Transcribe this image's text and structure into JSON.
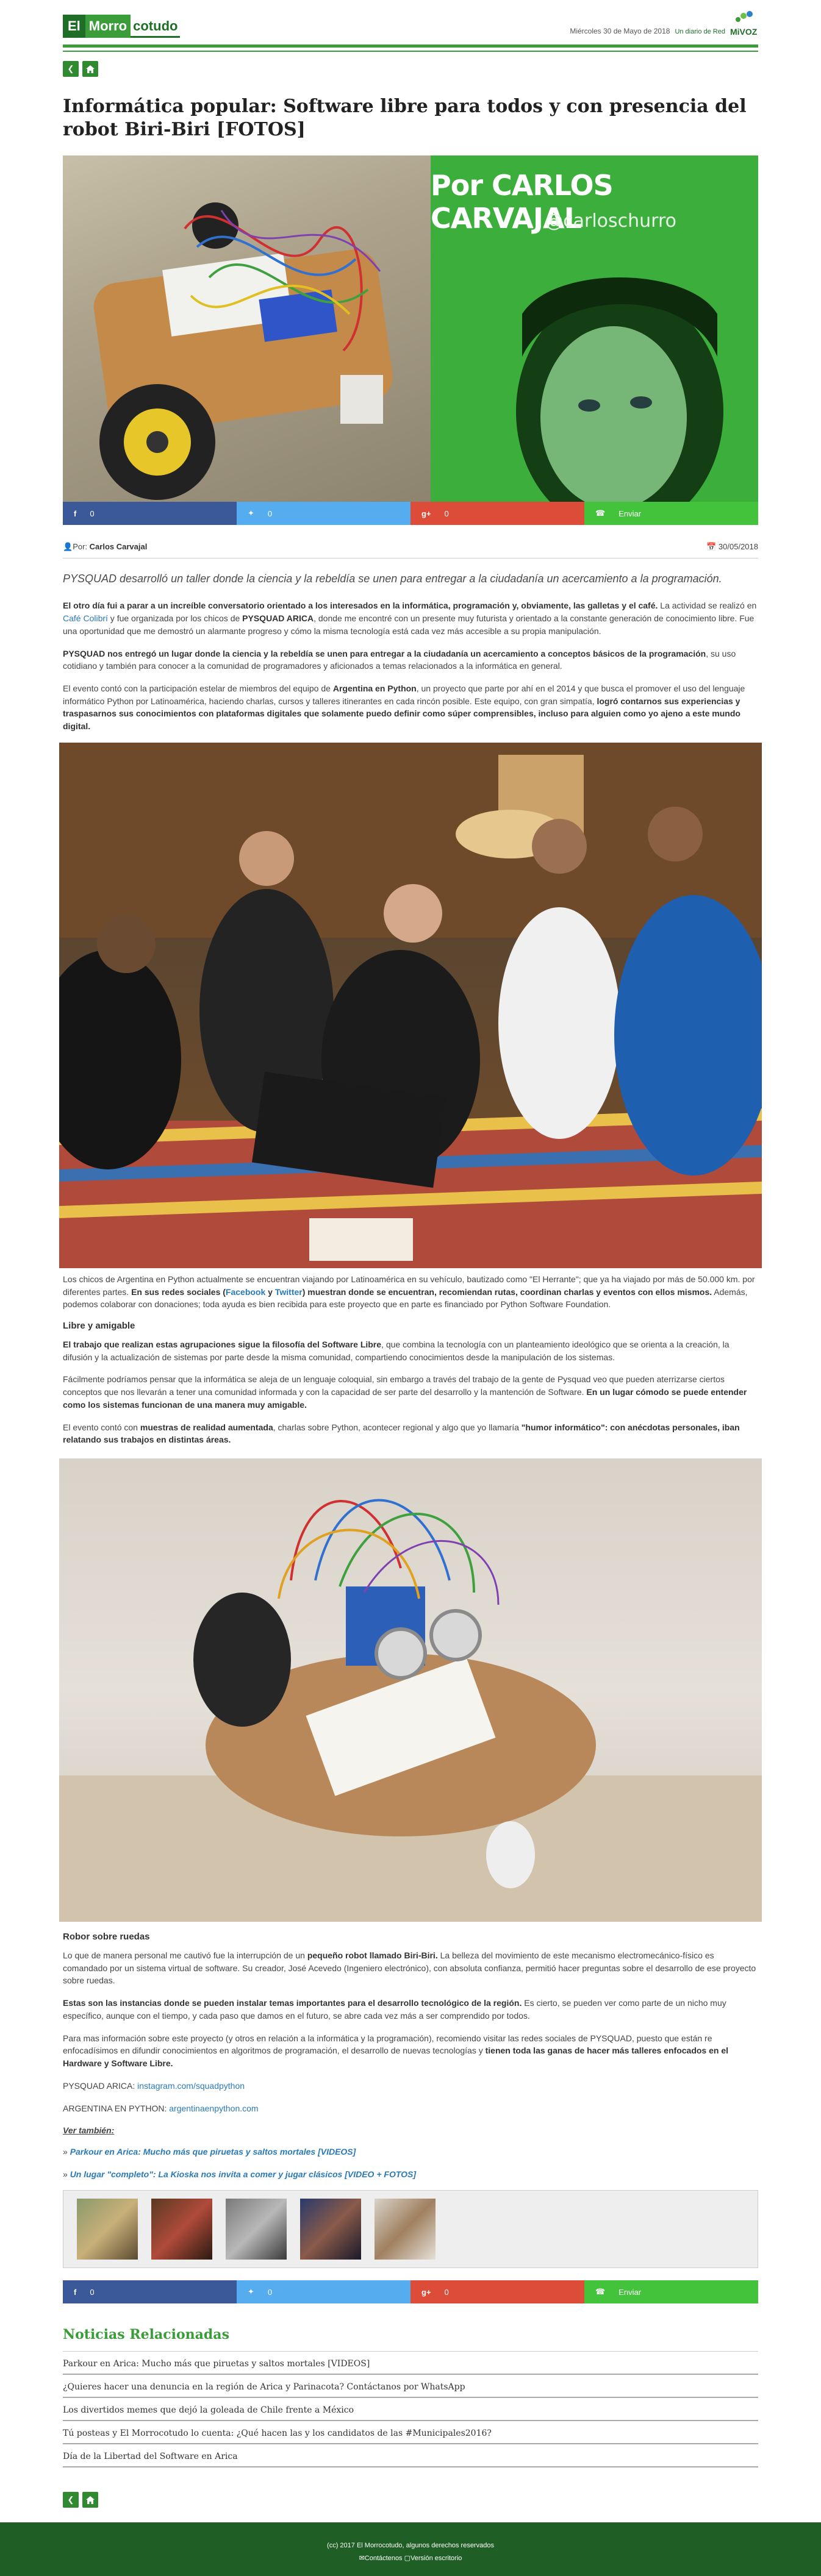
{
  "header": {
    "logo_part1": "El",
    "logo_part2": "Morro",
    "logo_part3": "cotudo",
    "date": "Miércoles 30 de Mayo de 2018",
    "network": "Un diario de Red",
    "network_brand": "MiVOZ"
  },
  "nav": {
    "back_icon": "chevron-left-icon",
    "home_icon": "home-icon"
  },
  "article": {
    "title": "Informática popular: Software libre para todos y con presencia del robot Biri-Biri [FOTOS]",
    "hero_name": "Por CARLOS CARVAJAL",
    "hero_handle": "@carloschurro",
    "author_prefix": "Por:",
    "author": "Carlos Carvajal",
    "date": "30/05/2018",
    "lead": "PYSQUAD desarrolló un taller donde la ciencia y la rebeldía se unen para entregar a la ciudadanía un acercamiento a la programación.",
    "p1_b": "El otro día fui a parar a un increíble conversatorio orientado a los interesados en la informática, programación y, obviamente, las galletas y el café.",
    "p1_a": " La actividad se realizó en ",
    "p1_link": "Café Colibrí",
    "p1_c": " y fue organizada por los chicos de ",
    "p1_b2": "PYSQUAD ARICA",
    "p1_d": ", donde me encontré con un presente muy futurista y orientado a la constante generación de conocimiento libre. Fue una oportunidad que me demostró un alarmante progreso y cómo la misma tecnología está cada vez más accesible a su propia manipulación.",
    "p2_b": "PYSQUAD nos entregó un lugar donde la ciencia y la rebeldía se unen para entregar a la ciudadanía un acercamiento a conceptos básicos de la programación",
    "p2_a": ", su uso cotidiano y también para conocer a la comunidad de programadores y aficionados a temas relacionados a la informática en general.",
    "p3_a": "El evento contó con la participación estelar de miembros del equipo de ",
    "p3_b": "Argentina en Python",
    "p3_c": ", un proyecto que parte por ahí en el 2014 y que busca el promover el uso del lenguaje informático Python por Latinoamérica, haciendo charlas, cursos y talleres itinerantes en cada rincón posible. Este equipo, con gran simpatía, ",
    "p3_d": "logró contarnos sus experiencias y traspasarnos sus conocimientos con plataformas digitales que solamente puedo definir como súper comprensibles, incluso para alguien como yo ajeno a este mundo digital.",
    "caption1_a": "Los chicos de Argentina en Python actualmente se encuentran viajando por Latinoamérica en su vehículo, bautizado como \"El Herrante\"; que ya ha viajado por más de 50.000 km. por diferentes partes. ",
    "caption1_b": "En sus redes sociales (",
    "caption1_fb": "Facebook",
    "caption1_y": " y ",
    "caption1_tw": "Twitter",
    "caption1_c": ") muestran donde se encuentran, recomiendan rutas, coordinan charlas y eventos con ellos mismos.",
    "caption1_d": " Además, podemos colaborar con donaciones; toda ayuda es bien recibida para este proyecto que en parte es financiado por Python Software Foundation.",
    "h_libre": "Libre y amigable",
    "p4_b": "El trabajo que realizan estas agrupaciones sigue la filosofía del Software Libre",
    "p4_a": ", que combina la tecnología con un planteamiento ideológico que se orienta a la creación, la difusión y la actualización de sistemas por parte desde la misma comunidad, compartiendo conocimientos desde la manipulación de los sistemas.",
    "p5_a": "Fácilmente podríamos pensar que la informática se aleja de un lenguaje coloquial, sin embargo a través del trabajo de la gente de Pysquad veo que pueden aterrizarse ciertos conceptos que nos llevarán a tener una comunidad informada y con la capacidad de ser parte del desarrollo y la mantención de Software. ",
    "p5_b": "En un lugar cómodo se puede entender como los sistemas funcionan de una manera muy amigable.",
    "p6_a": "El evento contó con ",
    "p6_b": "muestras de realidad aumentada",
    "p6_c": ", charlas sobre Python, acontecer regional y algo que yo llamaría ",
    "p6_d": "\"humor informático\": con anécdotas personales, iban relatando sus trabajos en distintas áreas.",
    "h_robot": "Robor sobre ruedas",
    "p7_a": "Lo que de manera personal me cautivó fue la interrupción de un ",
    "p7_b": "pequeño robot llamado Biri-Biri.",
    "p7_c": " La belleza del movimiento de este mecanismo electromecánico-físico es comandado por un sistema virtual de software. Su creador, José Acevedo (Ingeniero electrónico), con absoluta confianza, permitió hacer preguntas sobre el desarrollo de ese proyecto sobre ruedas.",
    "p8_b": "Estas son las instancias donde se pueden instalar temas importantes para el desarrollo tecnológico de la región.",
    "p8_a": " Es cierto, se pueden ver como parte de un nicho muy específico, aunque con el tiempo, y cada paso que damos en el futuro, se abre cada vez más a ser comprendido por todos.",
    "p9_a": "Para mas información sobre este proyecto (y otros en relación a la informática y la programación), recomiendo visitar las redes sociales de PYSQUAD, puesto que están re enfocadísimos en difundir conocimientos en algoritmos de programación, el desarrollo de nuevas tecnologías y ",
    "p9_b": "tienen toda las ganas de hacer más talleres enfocados en el Hardware y Software Libre.",
    "link_pysquad_label": "PYSQUAD ARICA: ",
    "link_pysquad": "instagram.com/squadpython",
    "link_arg_label": "ARGENTINA EN PYTHON: ",
    "link_arg": "argentinaenpython.com",
    "see_also": "Ver también:",
    "see1": "Parkour en Arica: Mucho más que piruetas y saltos mortales [VIDEOS]",
    "see2": "Un lugar \"completo\": La Kioska nos invita a comer y jugar clásicos [VIDEO + FOTOS]"
  },
  "share": {
    "fb_count": "0",
    "tw_count": "0",
    "gp_count": "0",
    "wa_label": "Enviar",
    "fb_icon": "facebook-icon",
    "tw_icon": "twitter-icon",
    "gp_icon": "google-plus-icon",
    "wa_icon": "whatsapp-icon"
  },
  "related": {
    "heading": "Noticias Relacionadas",
    "items": [
      "Parkour en Arica: Mucho más que piruetas y saltos mortales [VIDEOS]",
      "¿Quieres hacer una denuncia en la región de Arica y Parinacota? Contáctanos por WhatsApp",
      "Los divertidos memes que dejó la goleada de Chile frente a México",
      "Tú posteas y El Morrocotudo lo cuenta: ¿Qué hacen las y los candidatos de las #Municipales2016?",
      "Día de la Libertad del Software en Arica"
    ]
  },
  "footer": {
    "copyright": "(cc) 2017 El Morrocotudo, algunos derechos reservados",
    "contact": "Contáctenos",
    "desktop": "Versión escritorio"
  },
  "colors": {
    "brand_green": "#3a9d3a",
    "dark_green": "#1f6e28",
    "footer": "#1f5f26",
    "link": "#2a7ab8"
  }
}
